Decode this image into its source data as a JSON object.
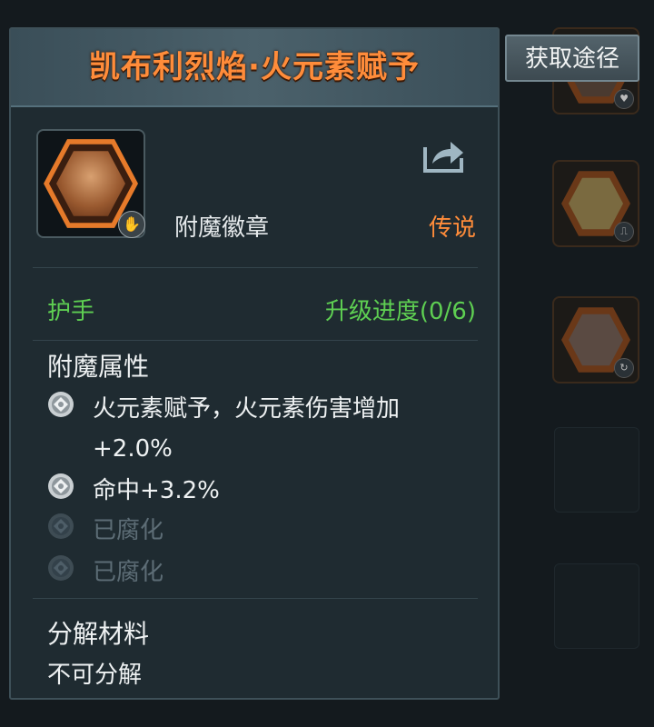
{
  "acquire_button": "获取途径",
  "item": {
    "title": "凯布利烈焰·火元素赋予",
    "type": "附魔徽章",
    "rarity": "传说",
    "slot": "护手",
    "upgrade_progress": "升级进度(0/6)"
  },
  "enchant": {
    "heading": "附魔属性",
    "attributes": [
      {
        "line1": "火元素赋予，火元素伤害增加",
        "line2": "+2.0%",
        "active": true
      },
      {
        "line1": "命中+3.2%",
        "active": true
      },
      {
        "line1": "已腐化",
        "active": false
      },
      {
        "line1": "已腐化",
        "active": false
      }
    ]
  },
  "decompose": {
    "heading": "分解材料",
    "value": "不可分解"
  },
  "icons": [
    "hand-icon",
    "share-icon",
    "attribute-gem-icon"
  ],
  "colors": {
    "title": "#ff8c3a",
    "rarity": "#ff8c3a",
    "green": "#5ecf52",
    "dim": "#5d6d76"
  }
}
